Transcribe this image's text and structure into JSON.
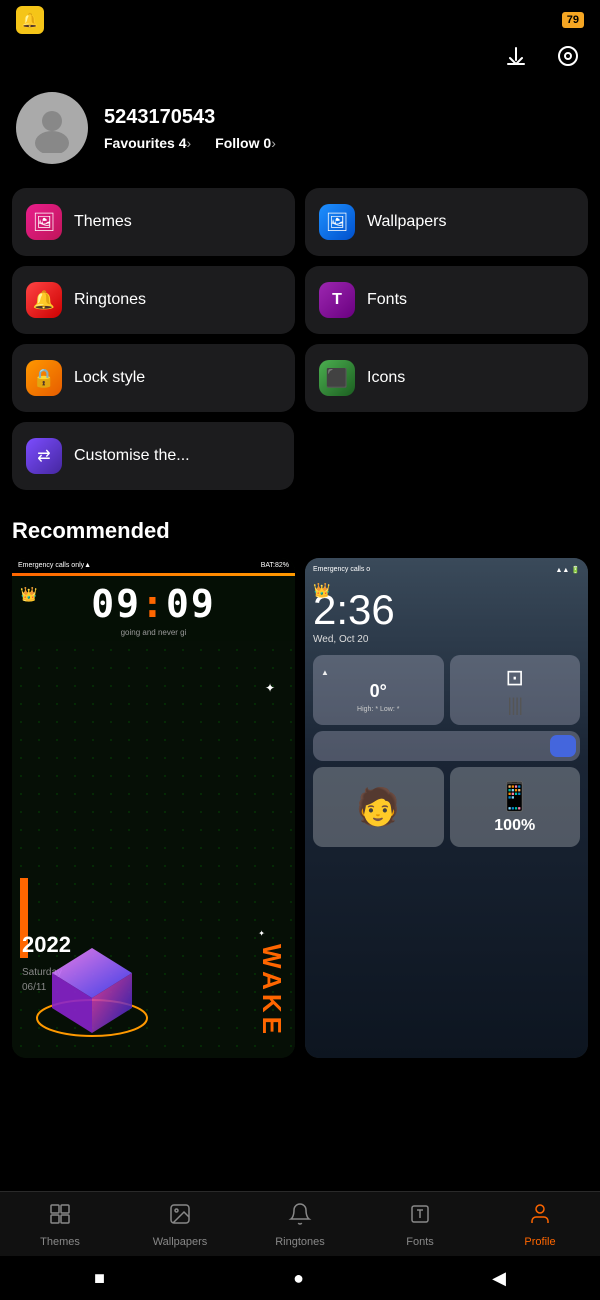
{
  "statusBar": {
    "appIcon": "🔔",
    "battery": "79"
  },
  "topActions": {
    "download": "⬇",
    "settings": "⚙"
  },
  "profile": {
    "username": "5243170543",
    "favourites": "4",
    "follow": "0",
    "favourites_label": "Favourites",
    "follow_label": "Follow"
  },
  "menuItems": [
    {
      "id": "themes",
      "label": "Themes",
      "icon": "🖼",
      "bgClass": "bg-pink"
    },
    {
      "id": "wallpapers",
      "label": "Wallpapers",
      "icon": "🟦",
      "bgClass": "bg-blue"
    },
    {
      "id": "ringtones",
      "label": "Ringtones",
      "icon": "🔔",
      "bgClass": "bg-red"
    },
    {
      "id": "fonts",
      "label": "Fonts",
      "icon": "T",
      "bgClass": "bg-purple"
    },
    {
      "id": "lockstyle",
      "label": "Lock style",
      "icon": "🔒",
      "bgClass": "bg-orange"
    },
    {
      "id": "icons",
      "label": "Icons",
      "icon": "⬛",
      "bgClass": "bg-green"
    }
  ],
  "customise": {
    "label": "Customise the...",
    "icon": "⇄",
    "bgClass": "bg-violet"
  },
  "recommended": {
    "title": "Recommended"
  },
  "leftCard": {
    "status": "Emergency calls only▲",
    "battery": "BAT:82%",
    "time": "09:09",
    "subtitle": "going and never gi",
    "year": "2022",
    "day": "Saturday",
    "date": "06/11",
    "wakeText": "WAKE"
  },
  "rightCard": {
    "status": "Emergency calls o",
    "time": "2:36",
    "date": "Wed, Oct 20",
    "temp": "0°",
    "highLow": "High: * Low: *",
    "battery": "100%"
  },
  "tabs": [
    {
      "id": "themes",
      "label": "Themes",
      "icon": "🖥",
      "active": false
    },
    {
      "id": "wallpapers",
      "label": "Wallpapers",
      "icon": "🖼",
      "active": false
    },
    {
      "id": "ringtones",
      "label": "Ringtones",
      "icon": "🔔",
      "active": false
    },
    {
      "id": "fonts",
      "label": "Fonts",
      "icon": "T",
      "active": false
    },
    {
      "id": "profile",
      "label": "Profile",
      "icon": "👤",
      "active": true
    }
  ],
  "navBar": {
    "square": "■",
    "circle": "●",
    "back": "◀"
  }
}
